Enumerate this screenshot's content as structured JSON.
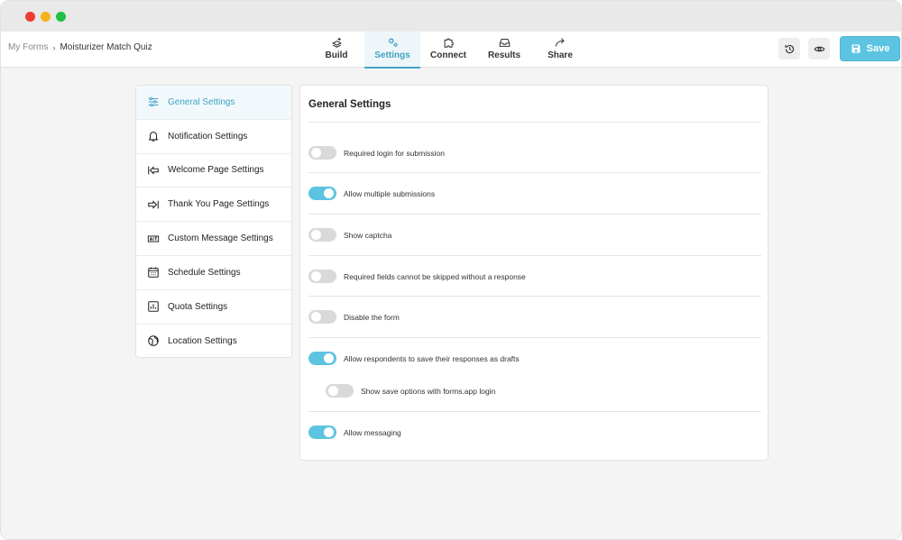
{
  "breadcrumb": {
    "root": "My Forms",
    "separator": "›",
    "current": "Moisturizer Match Quiz"
  },
  "tabs": [
    {
      "label": "Build",
      "icon": "build-icon"
    },
    {
      "label": "Settings",
      "icon": "gears-icon",
      "active": true
    },
    {
      "label": "Connect",
      "icon": "puzzle-icon"
    },
    {
      "label": "Results",
      "icon": "inbox-icon"
    },
    {
      "label": "Share",
      "icon": "share-arrow-icon"
    }
  ],
  "toolbar": {
    "save_label": "Save"
  },
  "sidebar": {
    "items": [
      {
        "label": "General Settings",
        "icon": "sliders-icon",
        "active": true
      },
      {
        "label": "Notification Settings",
        "icon": "bell-icon"
      },
      {
        "label": "Welcome Page Settings",
        "icon": "arrow-left-bar-icon"
      },
      {
        "label": "Thank You Page Settings",
        "icon": "arrow-right-bar-icon"
      },
      {
        "label": "Custom Message Settings",
        "icon": "message-box-icon"
      },
      {
        "label": "Schedule Settings",
        "icon": "calendar-icon"
      },
      {
        "label": "Quota Settings",
        "icon": "bar-chart-icon"
      },
      {
        "label": "Location Settings",
        "icon": "globe-icon"
      }
    ]
  },
  "panel": {
    "title": "General Settings",
    "settings": [
      {
        "label": "Required login for submission",
        "on": false
      },
      {
        "label": "Allow multiple submissions",
        "on": true
      },
      {
        "label": "Show captcha",
        "on": false
      },
      {
        "label": "Required fields cannot be skipped without a response",
        "on": false
      },
      {
        "label": "Disable the form",
        "on": false
      },
      {
        "label": "Allow respondents to save their responses as drafts",
        "on": true
      },
      {
        "label": "Show save options with forms.app login",
        "on": false
      },
      {
        "label": "Allow messaging",
        "on": true
      }
    ]
  },
  "colors": {
    "accent": "#5cc4e0",
    "accent_text": "#3fa4c4",
    "toggle_off": "#d9d9d9"
  }
}
